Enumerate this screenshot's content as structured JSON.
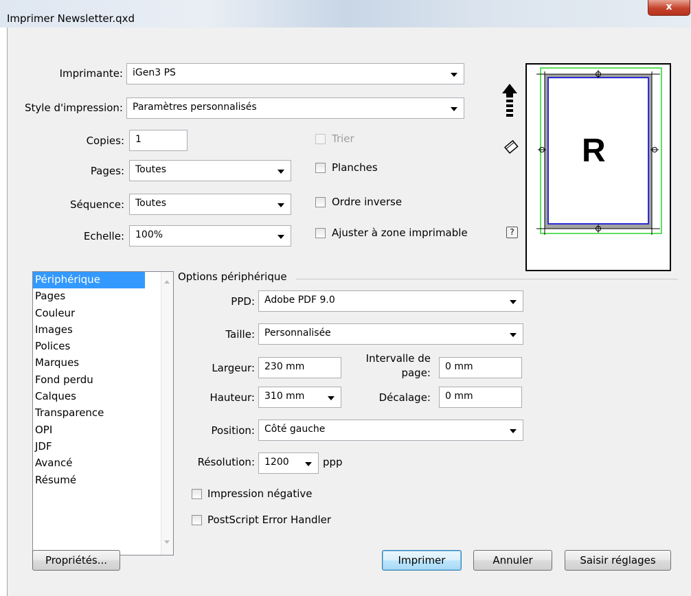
{
  "window": {
    "title": "Imprimer Newsletter.qxd",
    "close_label": "x"
  },
  "printer": {
    "label": "Imprimante:",
    "value": "iGen3 PS"
  },
  "print_style": {
    "label": "Style d'impression:",
    "value": "Paramètres personnalisés"
  },
  "copies": {
    "label": "Copies:",
    "value": "1"
  },
  "pages": {
    "label": "Pages:",
    "value": "Toutes"
  },
  "sequence": {
    "label": "Séquence:",
    "value": "Toutes"
  },
  "scale": {
    "label": "Echelle:",
    "value": "100%"
  },
  "checkboxes": {
    "collate": {
      "label": "Trier",
      "checked": false,
      "disabled": true
    },
    "spreads": {
      "label": "Planches",
      "checked": false
    },
    "reverse_order": {
      "label": "Ordre inverse",
      "checked": false
    },
    "fit_printable": {
      "label": "Ajuster à zone imprimable",
      "checked": false
    }
  },
  "preview": {
    "letter": "R",
    "help_label": "?"
  },
  "categories": {
    "selected": "Périphérique",
    "items": [
      "Périphérique",
      "Pages",
      "Couleur",
      "Images",
      "Polices",
      "Marques",
      "Fond perdu",
      "Calques",
      "Transparence",
      "OPI",
      "JDF",
      "Avancé",
      "Résumé"
    ]
  },
  "device_options": {
    "group_title": "Options périphérique",
    "ppd": {
      "label": "PPD:",
      "value": "Adobe PDF 9.0"
    },
    "size": {
      "label": "Taille:",
      "value": "Personnalisée"
    },
    "width": {
      "label": "Largeur:",
      "value": "230 mm"
    },
    "page_gap": {
      "label_line1": "Intervalle de",
      "label_line2": "page:",
      "value": "0 mm"
    },
    "height": {
      "label": "Hauteur:",
      "value": "310 mm"
    },
    "offset": {
      "label": "Décalage:",
      "value": "0 mm"
    },
    "position": {
      "label": "Position:",
      "value": "Côté gauche"
    },
    "resolution": {
      "label": "Résolution:",
      "value": "1200",
      "unit": "ppp"
    },
    "negative_print": {
      "label": "Impression négative",
      "checked": false
    },
    "ps_error_handler": {
      "label": "PostScript Error Handler",
      "checked": false
    }
  },
  "buttons": {
    "properties": "Propriétés...",
    "print": "Imprimer",
    "cancel": "Annuler",
    "capture_settings": "Saisir réglages"
  },
  "colors": {
    "selection": "#3399ff",
    "page_border_blue": "#2b2bd6",
    "printable_area_green": "#28d628",
    "close_button": "#c4432c"
  }
}
